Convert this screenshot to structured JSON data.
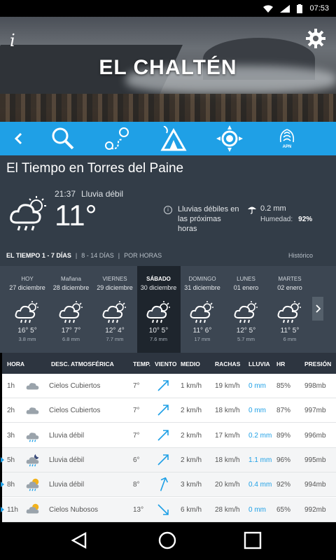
{
  "status": {
    "time": "07:53"
  },
  "header": {
    "city": "EL CHALTÉN",
    "info_label": "i"
  },
  "nav": {
    "icons": [
      "back-icon",
      "search-icon",
      "route-icon",
      "camping-icon",
      "sun-icon",
      "apn-icon"
    ],
    "apn_label": "APN"
  },
  "main": {
    "title": "El Tiempo en Torres del Paine",
    "time": "21:37",
    "condition": "Lluvia débil",
    "temp": "11°",
    "rain_note": "Lluvias débiles en las próximas horas",
    "precip": "0.2 mm",
    "humidity_label": "Humedad:",
    "humidity": "92%",
    "tabs": [
      "EL TIEMPO 1 - 7 DÍAS",
      "|",
      "8 - 14 DÍAS",
      "|",
      "POR HORAS"
    ],
    "history": "Histórico"
  },
  "days": [
    {
      "name": "HOY",
      "date": "27 diciembre",
      "temps": "16° 5°",
      "precip": "3.8 mm"
    },
    {
      "name": "Mañana",
      "date": "28 diciembre",
      "temps": "17° 7°",
      "precip": "6.8 mm"
    },
    {
      "name": "VIERNES",
      "date": "29 diciembre",
      "temps": "12° 4°",
      "precip": "7.7 mm"
    },
    {
      "name": "SÁBADO",
      "date": "30 diciembre",
      "temps": "10° 5°",
      "precip": "7.6 mm"
    },
    {
      "name": "DOMINGO",
      "date": "31 diciembre",
      "temps": "11° 6°",
      "precip": "17 mm"
    },
    {
      "name": "LUNES",
      "date": "01 enero",
      "temps": "12° 5°",
      "precip": "5.7 mm"
    },
    {
      "name": "MARTES",
      "date": "02 enero",
      "temps": "11° 5°",
      "precip": "6 mm"
    }
  ],
  "table": {
    "headers": [
      "HORA",
      "DESC. ATMOSFÉRICA",
      "TEMP.",
      "VIENTO",
      "MEDIO",
      "RACHAS",
      "LLUVIA",
      "HR",
      "PRESIÓN"
    ],
    "rows": [
      {
        "hour": "1h",
        "icon": "cloudy-icon",
        "desc": "Cielos Cubiertos",
        "temp": "7°",
        "wind_dir": "wind-ne-icon",
        "medio": "1 km/h",
        "rachas": "19 km/h",
        "lluvia": "0 mm",
        "hr": "85%",
        "presion": "998mb"
      },
      {
        "hour": "2h",
        "icon": "cloudy-icon",
        "desc": "Cielos Cubiertos",
        "temp": "7°",
        "wind_dir": "wind-ne-icon",
        "medio": "2 km/h",
        "rachas": "18 km/h",
        "lluvia": "0 mm",
        "hr": "87%",
        "presion": "997mb"
      },
      {
        "hour": "3h",
        "icon": "rain-icon",
        "desc": "Lluvia débil",
        "temp": "7°",
        "wind_dir": "wind-ne-icon",
        "medio": "2 km/h",
        "rachas": "17 km/h",
        "lluvia": "0.2 mm",
        "hr": "89%",
        "presion": "996mb"
      },
      {
        "hour": "5h",
        "icon": "night-rain-icon",
        "desc": "Lluvia débil",
        "temp": "6°",
        "wind_dir": "wind-ne-icon",
        "medio": "2 km/h",
        "rachas": "18 km/h",
        "lluvia": "1.1 mm",
        "hr": "96%",
        "presion": "995mb"
      },
      {
        "hour": "8h",
        "icon": "sun-rain-icon",
        "desc": "Lluvia débil",
        "temp": "8°",
        "wind_dir": "wind-n-icon",
        "medio": "3 km/h",
        "rachas": "20 km/h",
        "lluvia": "0.4 mm",
        "hr": "92%",
        "presion": "994mb"
      },
      {
        "hour": "11h",
        "icon": "partly-cloudy-icon",
        "desc": "Cielos Nubosos",
        "temp": "13°",
        "wind_dir": "wind-nw-icon",
        "medio": "6 km/h",
        "rachas": "28 km/h",
        "lluvia": "0 mm",
        "hr": "65%",
        "presion": "992mb"
      }
    ]
  },
  "colors": {
    "accent": "#1fa0e6",
    "panel": "#333d48",
    "selected_day": "#1e252d"
  }
}
